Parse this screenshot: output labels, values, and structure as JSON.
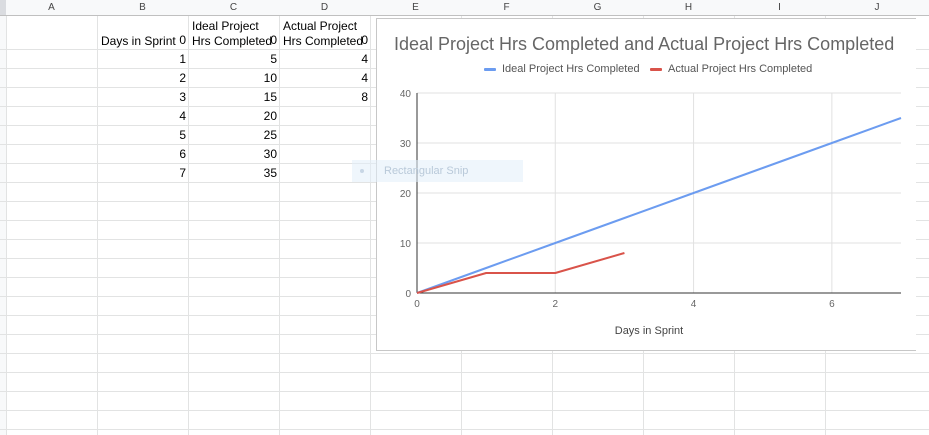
{
  "column_headers": [
    "A",
    "B",
    "C",
    "D",
    "E",
    "F",
    "G",
    "H",
    "I",
    "J"
  ],
  "table": {
    "header_b": "Days in Sprint",
    "header_c_line1": "Ideal Project",
    "header_c_line2": "Hrs Completed",
    "header_d_line1": "Actual Project",
    "header_d_line2": "Hrs Completed",
    "days": [
      "0",
      "1",
      "2",
      "3",
      "4",
      "5",
      "6",
      "7"
    ],
    "ideal": [
      "0",
      "5",
      "10",
      "15",
      "20",
      "25",
      "30",
      "35"
    ],
    "actual": [
      "0",
      "4",
      "4",
      "8"
    ]
  },
  "snip_overlay": {
    "label": "Rectangular Snip"
  },
  "colors": {
    "ideal": "#6c9cf0",
    "actual": "#d9534a",
    "grid": "#e1e1e1",
    "axis": "#333333"
  },
  "chart_data": {
    "type": "line",
    "title": "Ideal Project Hrs Completed and Actual Project Hrs Completed",
    "xlabel": "Days in Sprint",
    "ylabel": "",
    "xlim": [
      0,
      7
    ],
    "ylim": [
      0,
      40
    ],
    "x_ticks": [
      0,
      2,
      4,
      6
    ],
    "y_ticks": [
      0,
      10,
      20,
      30,
      40
    ],
    "grid": true,
    "legend_position": "top",
    "series": [
      {
        "name": "Ideal Project Hrs Completed",
        "x": [
          0,
          1,
          2,
          3,
          4,
          5,
          6,
          7
        ],
        "values": [
          0,
          5,
          10,
          15,
          20,
          25,
          30,
          35
        ]
      },
      {
        "name": "Actual Project Hrs Completed",
        "x": [
          0,
          1,
          2,
          3
        ],
        "values": [
          0,
          4,
          4,
          8
        ]
      }
    ]
  }
}
